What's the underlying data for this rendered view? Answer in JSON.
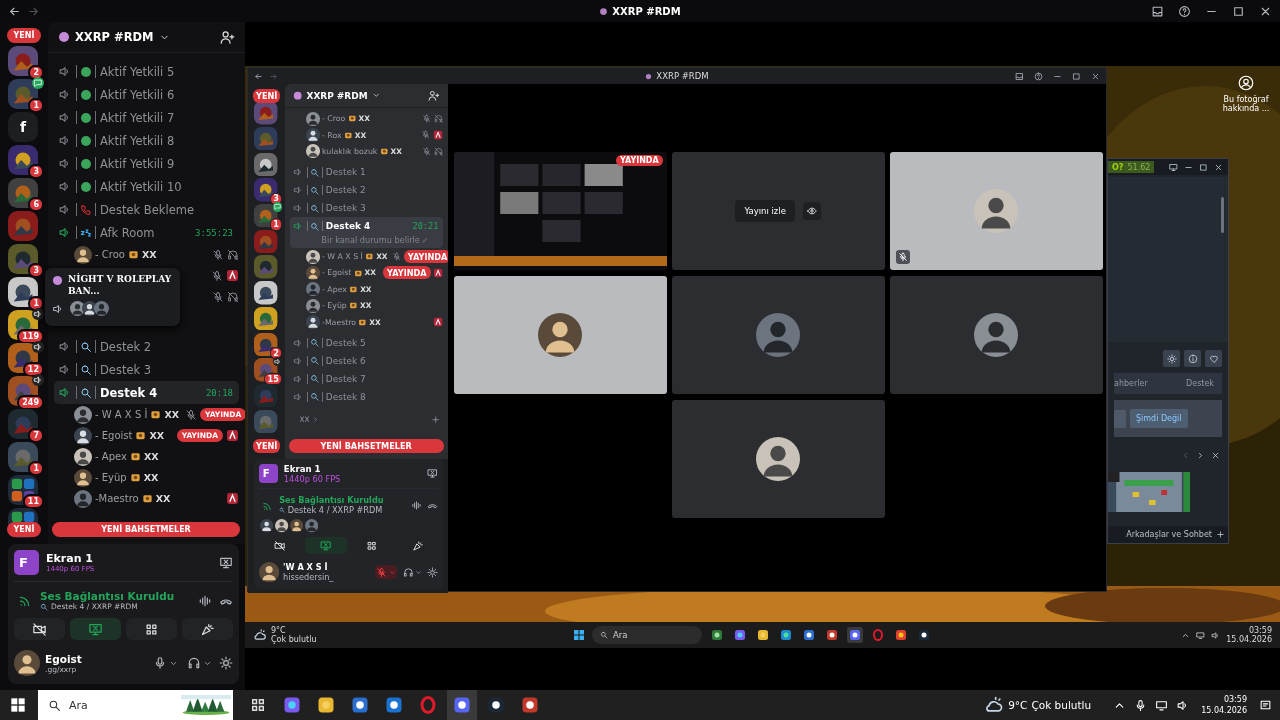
{
  "top_bar": {
    "title": "XXRP #RDM"
  },
  "discord": {
    "new_top": "YENİ",
    "header": "XXRP #RDM",
    "servers": [
      {
        "kind": "server",
        "badge": "2"
      },
      {
        "kind": "chatserver",
        "badge": "1"
      },
      {
        "kind": "server",
        "label": "f"
      },
      {
        "kind": "server",
        "badge": "3"
      },
      {
        "kind": "server",
        "badge": "6"
      },
      {
        "kind": "server"
      },
      {
        "kind": "server",
        "badge": "3"
      },
      {
        "kind": "server",
        "badge": "1"
      },
      {
        "kind": "voiceserver",
        "badge": "119"
      },
      {
        "kind": "voiceserver",
        "badge": "12"
      },
      {
        "kind": "voiceserver",
        "badge": "249"
      },
      {
        "kind": "server",
        "badge": "7"
      },
      {
        "kind": "server",
        "badge": "1"
      },
      {
        "kind": "folder",
        "badge": "11"
      },
      {
        "kind": "folder"
      }
    ],
    "channels": [
      {
        "kind": "status",
        "name": "Aktif Yetkili 5",
        "active": false,
        "selected": false
      },
      {
        "kind": "status",
        "name": "Aktif Yetkili 6",
        "active": false,
        "selected": false
      },
      {
        "kind": "status",
        "name": "Aktif Yetkili 7",
        "active": false,
        "selected": false
      },
      {
        "kind": "status",
        "name": "Aktif Yetkili 8",
        "active": false,
        "selected": false
      },
      {
        "kind": "status",
        "name": "Aktif Yetkili 9",
        "active": false,
        "selected": false
      },
      {
        "kind": "status",
        "name": "Aktif Yetkili 10",
        "active": false,
        "selected": false
      },
      {
        "kind": "phone",
        "name": "Destek Bekleme",
        "active": false,
        "selected": false
      },
      {
        "kind": "sleep",
        "name": "Afk Room",
        "active": true,
        "selected": false,
        "time": "3:55:23"
      },
      {
        "kind": "member",
        "name": "- Croo",
        "tag": "XX",
        "right": [
          {
            "kind": "mic-off"
          },
          {
            "kind": "deaf"
          }
        ]
      },
      {
        "kind": "member",
        "right": [
          {
            "kind": "mic-off"
          },
          {
            "kind": "app"
          }
        ]
      },
      {
        "kind": "member",
        "right": [
          {
            "kind": "mic-off"
          },
          {
            "kind": "deaf"
          }
        ]
      },
      {
        "kind": "covered"
      },
      {
        "kind": "search",
        "name": "Destek 2",
        "active": false,
        "selected": false
      },
      {
        "kind": "search",
        "name": "Destek 3",
        "active": false,
        "selected": false
      },
      {
        "kind": "search",
        "name": "Destek 4",
        "active": true,
        "selected": true,
        "time": "20:18"
      },
      {
        "kind": "member",
        "name": "- W A X S İ",
        "tag": "XX",
        "right": [
          {
            "kind": "mic-off"
          },
          {
            "kind": "live",
            "label": "YAYINDA"
          }
        ]
      },
      {
        "kind": "member",
        "name": "- Egoist",
        "tag": "XX",
        "right": [
          {
            "kind": "live",
            "label": "YAYINDA"
          },
          {
            "kind": "app"
          }
        ]
      },
      {
        "kind": "member",
        "name": "- Apex",
        "tag": "XX"
      },
      {
        "kind": "member",
        "name": "- Eyüp",
        "tag": "XX"
      },
      {
        "kind": "member",
        "name": "-Maestro",
        "tag": "XX",
        "right": [
          {
            "kind": "app"
          }
        ]
      }
    ],
    "new_bottom": "YENİ",
    "mentions": "YENİ BAHSETMELER",
    "stream": {
      "initial": "F",
      "title": "Ekran 1",
      "quality": "1440p 60 FPS"
    },
    "voice": {
      "status": "Ses Bağlantısı Kuruldu",
      "channel": "Destek 4 / XXRP #RDM"
    },
    "controls": [
      {
        "kind": "camera",
        "on": false
      },
      {
        "kind": "screen",
        "on": true
      },
      {
        "kind": "activity",
        "on": false
      },
      {
        "kind": "soundboard",
        "on": false
      }
    ],
    "user": {
      "name": "Egoist",
      "status": ".gg/xxrp",
      "muted": false
    }
  },
  "popup": {
    "title": "NİGHT V ROLEPLAY BAN..."
  },
  "stream_view": {
    "desktop_icon": "Bu fotoğraf hakkında ...",
    "inner_window": {
      "title": "XXRP #RDM",
      "discord": {
        "new_top": "YENİ",
        "header": "XXRP #RDM",
        "servers": [
          {
            "kind": "server"
          },
          {
            "kind": "server"
          },
          {
            "kind": "server"
          },
          {
            "kind": "server",
            "badge": "3"
          },
          {
            "kind": "chatserver",
            "badge": "1"
          },
          {
            "kind": "server"
          },
          {
            "kind": "server"
          },
          {
            "kind": "server"
          },
          {
            "kind": "server"
          },
          {
            "kind": "server",
            "badge": "2"
          },
          {
            "kind": "voiceserver",
            "badge": "15"
          },
          {
            "kind": "server"
          },
          {
            "kind": "server"
          }
        ],
        "channels": [
          {
            "kind": "member",
            "name": "- Croo",
            "tag": "XX",
            "right": [
              {
                "kind": "mic-off"
              },
              {
                "kind": "deaf"
              }
            ]
          },
          {
            "kind": "member",
            "name": "- Rox",
            "tag": "XX",
            "right": [
              {
                "kind": "mic-off"
              },
              {
                "kind": "app"
              }
            ]
          },
          {
            "kind": "member",
            "name": "kulaklık bozuk",
            "tag": "XX",
            "right": [
              {
                "kind": "mic-off"
              },
              {
                "kind": "deaf"
              }
            ]
          },
          {
            "kind": "search",
            "name": "Destek 1",
            "active": false,
            "selected": false
          },
          {
            "kind": "search",
            "name": "Destek 2",
            "active": false,
            "selected": false
          },
          {
            "kind": "search",
            "name": "Destek 3",
            "active": false,
            "selected": false
          },
          {
            "kind": "search",
            "name": "Destek 4",
            "active": true,
            "selected": true,
            "time": "20:21",
            "subtitle": "Bir kanal durumu belirle"
          },
          {
            "kind": "member",
            "name": "- W A X S İ",
            "tag": "XX",
            "right": [
              {
                "kind": "mic-off"
              },
              {
                "kind": "live",
                "label": "YAYINDA"
              }
            ]
          },
          {
            "kind": "member",
            "name": "- Egoist",
            "tag": "XX",
            "right": [
              {
                "kind": "live",
                "label": "YAYINDA"
              },
              {
                "kind": "app"
              }
            ]
          },
          {
            "kind": "member",
            "name": "- Apex",
            "tag": "XX"
          },
          {
            "kind": "member",
            "name": "- Eyüp",
            "tag": "XX"
          },
          {
            "kind": "member",
            "name": "-Maestro",
            "tag": "XX",
            "right": [
              {
                "kind": "app"
              }
            ]
          },
          {
            "kind": "search",
            "name": "Destek 5",
            "active": false,
            "selected": false
          },
          {
            "kind": "search",
            "name": "Destek 6",
            "active": false,
            "selected": false
          },
          {
            "kind": "search",
            "name": "Destek 7",
            "active": false,
            "selected": false
          },
          {
            "kind": "search",
            "name": "Destek 8",
            "active": false,
            "selected": false
          },
          {
            "kind": "category",
            "name": "XX"
          }
        ],
        "new_bottom": "YENİ",
        "mentions": "YENİ BAHSETMELER",
        "stream": {
          "initial": "F",
          "title": "Ekran 1",
          "quality": "1440p 60 FPS"
        },
        "voice": {
          "status": "Ses Bağlantısı Kuruldu",
          "channel": "Destek 4 / XXRP #RDM",
          "participants": [
            {
              "kind": "avatar"
            },
            {
              "kind": "avatar"
            },
            {
              "kind": "avatar"
            },
            {
              "kind": "avatar"
            }
          ]
        },
        "controls": [
          {
            "kind": "camera",
            "on": false
          },
          {
            "kind": "screen",
            "on": true
          },
          {
            "kind": "activity",
            "on": false
          },
          {
            "kind": "soundboard",
            "on": false
          }
        ],
        "user": {
          "name": "'W A X S İ",
          "status": "hissedersin_",
          "muted": true
        }
      },
      "tiles": [
        {
          "kind": "screen",
          "badge": "YAYINDA"
        },
        {
          "kind": "watch",
          "button": "Yayını izle"
        },
        {
          "kind": "avatar",
          "lit": true,
          "muted": true
        },
        {
          "kind": "avatar",
          "lit": true,
          "muted": false
        },
        {
          "kind": "avatar",
          "lit": false,
          "muted": false
        },
        {
          "kind": "avatar",
          "lit": false,
          "muted": false
        },
        {
          "kind": "empty"
        },
        {
          "kind": "avatar",
          "lit": false,
          "muted": false
        }
      ]
    },
    "steam": {
      "status_label": "O?",
      "status_value": "51.62",
      "tabs": [
        "ahberler",
        "Destek"
      ],
      "button": "Şimdi Değil",
      "footer": "Arkadaşlar ve Sohbet"
    },
    "taskbar": {
      "temperature": "9°C",
      "weather": "Çok bulutlu",
      "search": "Ara",
      "apps": [
        {
          "kind": "game",
          "selected": false
        },
        {
          "kind": "copilot",
          "selected": false
        },
        {
          "kind": "explorer",
          "selected": false
        },
        {
          "kind": "edge",
          "selected": false
        },
        {
          "kind": "store",
          "selected": false
        },
        {
          "kind": "app",
          "selected": false
        },
        {
          "kind": "discord",
          "selected": true
        },
        {
          "kind": "opera",
          "selected": false
        },
        {
          "kind": "chrome",
          "selected": false
        },
        {
          "kind": "steam",
          "selected": false
        }
      ],
      "time": "03:59",
      "date": "15.04.2026"
    }
  },
  "taskbar": {
    "search": "Ara",
    "apps": [
      {
        "kind": "taskview",
        "selected": false
      },
      {
        "kind": "copilot",
        "selected": false
      },
      {
        "kind": "explorer",
        "selected": false
      },
      {
        "kind": "store",
        "selected": false
      },
      {
        "kind": "mail",
        "selected": false
      },
      {
        "kind": "opera",
        "selected": false
      },
      {
        "kind": "discord",
        "selected": true
      },
      {
        "kind": "steam",
        "selected": false
      },
      {
        "kind": "app",
        "selected": false
      }
    ],
    "temperature": "9°C",
    "weather": "Çok bulutlu",
    "time": "03:59",
    "date": "15.04.2026"
  }
}
